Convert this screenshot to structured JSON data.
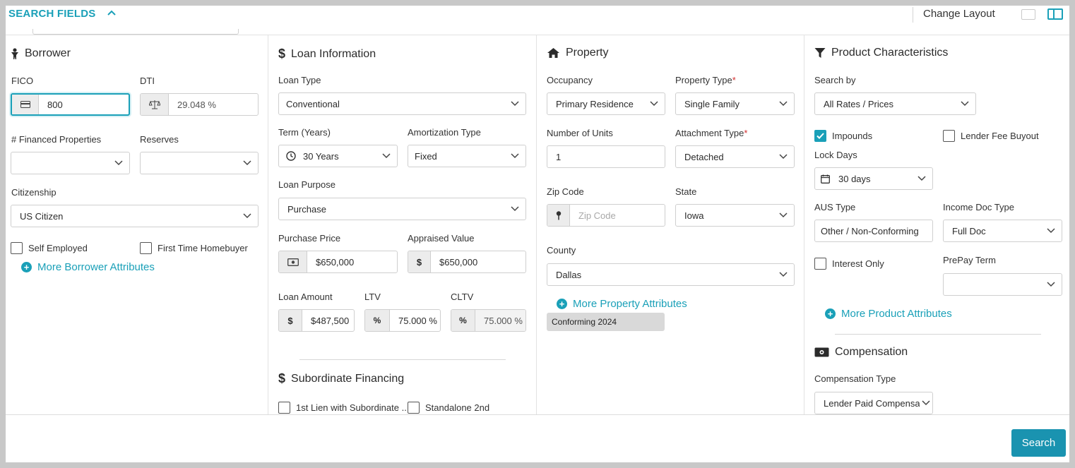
{
  "header": {
    "title": "SEARCH FIELDS",
    "change_layout": "Change Layout"
  },
  "borrower": {
    "title": "Borrower",
    "fico_label": "FICO",
    "fico_value": "800",
    "dti_label": "DTI",
    "dti_value": "29.048 %",
    "financed_props_label": "# Financed Properties",
    "reserves_label": "Reserves",
    "citizenship_label": "Citizenship",
    "citizenship_value": "US Citizen",
    "self_employed": "Self Employed",
    "first_time": "First Time Homebuyer",
    "more": "More Borrower Attributes"
  },
  "loan": {
    "title": "Loan Information",
    "loan_type_label": "Loan Type",
    "loan_type_value": "Conventional",
    "term_label": "Term (Years)",
    "term_value": "30 Years",
    "amort_label": "Amortization Type",
    "amort_value": "Fixed",
    "purpose_label": "Loan Purpose",
    "purpose_value": "Purchase",
    "price_label": "Purchase Price",
    "price_value": "$650,000",
    "appraised_label": "Appraised Value",
    "appraised_value": "$650,000",
    "amount_label": "Loan Amount",
    "amount_value": "$487,500",
    "ltv_label": "LTV",
    "ltv_value": "75.000 %",
    "cltv_label": "CLTV",
    "cltv_value": "75.000 %"
  },
  "subordinate": {
    "title": "Subordinate Financing",
    "first_lien": "1st Lien with Subordinate ...",
    "standalone": "Standalone 2nd"
  },
  "property": {
    "title": "Property",
    "occupancy_label": "Occupancy",
    "occupancy_value": "Primary Residence",
    "type_label": "Property Type",
    "type_value": "Single Family",
    "units_label": "Number of Units",
    "units_value": "1",
    "attach_label": "Attachment Type",
    "attach_value": "Detached",
    "zip_label": "Zip Code",
    "zip_placeholder": "Zip Code",
    "state_label": "State",
    "state_value": "Iowa",
    "county_label": "County",
    "county_value": "Dallas",
    "more": "More Property Attributes",
    "tag": "Conforming 2024"
  },
  "product": {
    "title": "Product Characteristics",
    "search_by_label": "Search by",
    "search_by_value": "All Rates / Prices",
    "impounds": "Impounds",
    "lender_fee": "Lender Fee Buyout",
    "lock_days_label": "Lock Days",
    "lock_days_value": "30 days",
    "aus_label": "AUS Type",
    "aus_value": "Other / Non-Conforming",
    "income_label": "Income Doc Type",
    "income_value": "Full Doc",
    "interest_only": "Interest Only",
    "prepay_label": "PrePay Term",
    "more": "More Product Attributes"
  },
  "compensation": {
    "title": "Compensation",
    "type_label": "Compensation Type",
    "type_value": "Lender Paid Compensation"
  },
  "footer": {
    "search": "Search"
  },
  "colors": {
    "accent": "#1aa0b8",
    "button": "#1a93b0"
  }
}
